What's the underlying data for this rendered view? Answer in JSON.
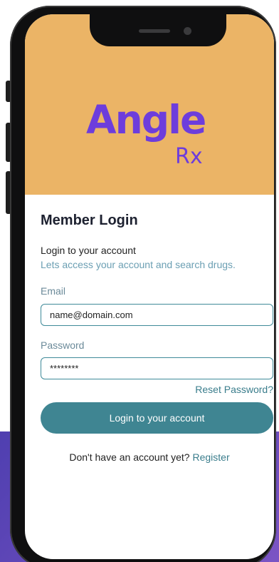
{
  "brand": {
    "name": "Angle",
    "suffix": "Rx",
    "colors": {
      "primary": "#6d3ddc",
      "header": "#ebb466",
      "accent": "#3f8592"
    }
  },
  "login": {
    "title": "Member Login",
    "subtitle": "Login to your account",
    "description": "Lets access your account and search drugs.",
    "email_label": "Email",
    "email_value": "name@domain.com",
    "password_label": "Password",
    "password_value": "********",
    "reset_link": "Reset Password?",
    "submit_label": "Login to your account",
    "signup_prompt": "Don't have an account yet?",
    "signup_link": "Register"
  }
}
